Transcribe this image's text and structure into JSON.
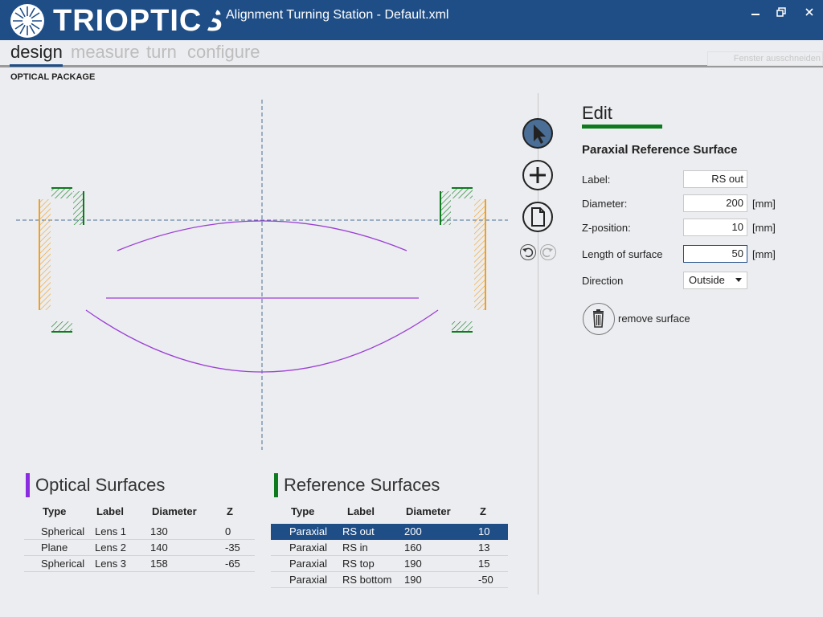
{
  "app": {
    "logo_text": "TRIOPTICS",
    "window_title": "Alignment Turning Station - Default.xml",
    "window_controls": [
      "minimize-icon",
      "restore-icon",
      "close-icon"
    ]
  },
  "nav": {
    "tabs": [
      {
        "label": "design",
        "active": true
      },
      {
        "label": "measure",
        "active": false
      },
      {
        "label": "turn",
        "active": false
      },
      {
        "label": "configure",
        "active": false
      }
    ],
    "snip_label": "Fenster ausschneiden"
  },
  "section_title": "OPTICAL PACKAGE",
  "tools": [
    "pointer-icon",
    "add-icon",
    "document-icon",
    "undo-icon",
    "redo-icon"
  ],
  "edit": {
    "title": "Edit",
    "subtitle": "Paraxial Reference Surface",
    "fields": {
      "label": {
        "label": "Label:",
        "value": "RS out"
      },
      "diameter": {
        "label": "Diameter:",
        "value": "200",
        "unit": "[mm]"
      },
      "zpos": {
        "label": "Z-position:",
        "value": "10",
        "unit": "[mm]"
      },
      "length": {
        "label": "Length of surface",
        "value": "50",
        "unit": "[mm]"
      },
      "direction": {
        "label": "Direction",
        "value": "Outside"
      }
    },
    "remove_label": "remove surface"
  },
  "optical_surfaces": {
    "title": "Optical Surfaces",
    "accent": "#8a2be2",
    "headers": [
      "Type",
      "Label",
      "Diameter",
      "Z"
    ],
    "rows": [
      [
        "Spherical",
        "Lens 1",
        "130",
        "0"
      ],
      [
        "Plane",
        "Lens 2",
        "140",
        "-35"
      ],
      [
        "Spherical",
        "Lens 3",
        "158",
        "-65"
      ]
    ]
  },
  "reference_surfaces": {
    "title": "Reference Surfaces",
    "accent": "#0c7a1d",
    "headers": [
      "Type",
      "Label",
      "Diameter",
      "Z"
    ],
    "rows": [
      [
        "Paraxial",
        "RS out",
        "200",
        "10"
      ],
      [
        "Paraxial",
        "RS in",
        "160",
        "13"
      ],
      [
        "Paraxial",
        "RS top",
        "190",
        "15"
      ],
      [
        "Paraxial",
        "RS bottom",
        "190",
        "-50"
      ]
    ],
    "selected_row": 0
  },
  "colors": {
    "titlebar": "#1f4e87",
    "lens": "#9b3fd6",
    "reference_green": "#0c7a1d",
    "mount_orange": "#f0a020",
    "axis": "#4a6e96"
  }
}
